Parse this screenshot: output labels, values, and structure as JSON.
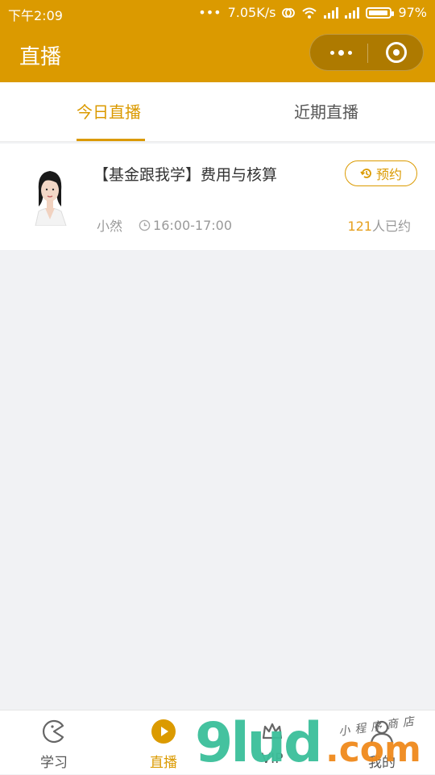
{
  "status_bar": {
    "time": "下午2:09",
    "dots": "•••",
    "speed": "7.05K/s",
    "battery": "97%"
  },
  "header": {
    "title": "直播"
  },
  "tabs": [
    {
      "label": "今日直播",
      "active": true
    },
    {
      "label": "近期直播",
      "active": false
    }
  ],
  "live_item": {
    "title": "【基金跟我学】费用与核算",
    "reserve_label": "预约",
    "host": "小然",
    "time": "16:00-17:00",
    "count": "121",
    "count_suffix": "人已约"
  },
  "bottom_nav": [
    {
      "label": "学习",
      "icon": "pacman-icon",
      "active": false
    },
    {
      "label": "直播",
      "icon": "play-circle-icon",
      "active": true
    },
    {
      "label": "VIP",
      "icon": "crown-icon",
      "active": false
    },
    {
      "label": "我的",
      "icon": "user-icon",
      "active": false
    }
  ],
  "watermark": {
    "brand": "9lud",
    "domain": ".com",
    "script": "小程序商店"
  },
  "colors": {
    "accent": "#db9a00",
    "count_orange": "#e6a01e",
    "page_bg": "#f1f2f4"
  }
}
